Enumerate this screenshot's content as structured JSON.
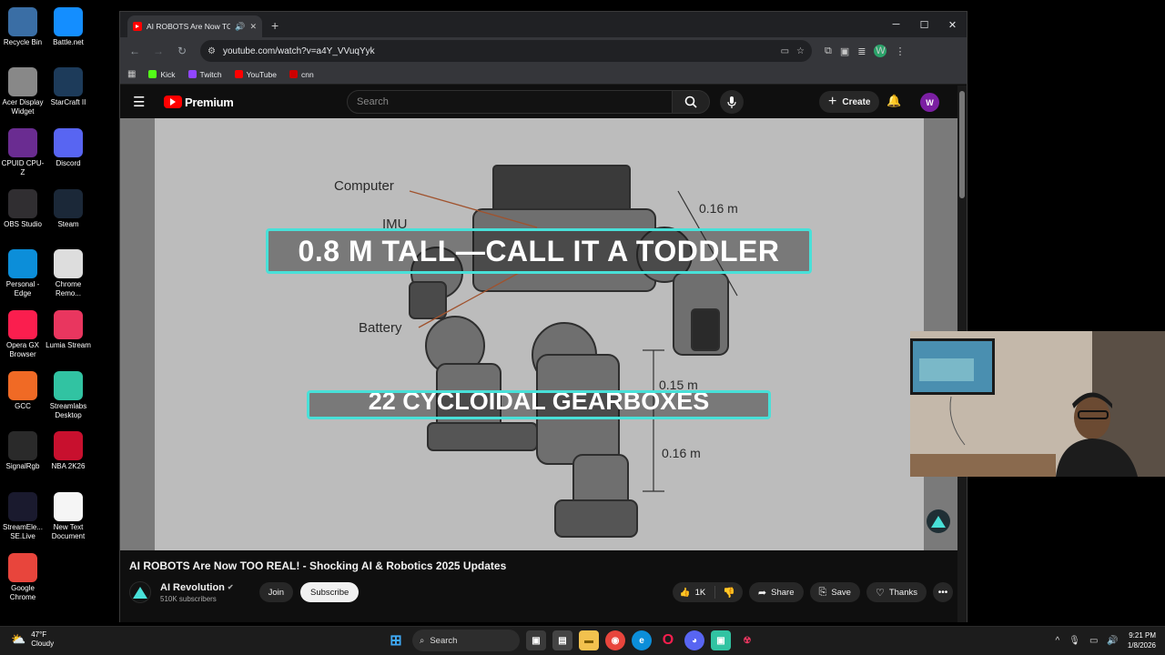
{
  "desktop": {
    "icons": [
      {
        "label": "Recycle Bin",
        "icon": "recycle-bin-icon",
        "color": "#3a6ea5"
      },
      {
        "label": "Battle.net",
        "icon": "battlenet-icon",
        "color": "#148eff"
      },
      {
        "label": "Acer Display Widget",
        "icon": "acer-icon",
        "color": "#888888"
      },
      {
        "label": "StarCraft II",
        "icon": "starcraft-icon",
        "color": "#1d3b5a"
      },
      {
        "label": "CPUID CPU-Z",
        "icon": "cpuz-icon",
        "color": "#6a2c91"
      },
      {
        "label": "Discord",
        "icon": "discord-icon",
        "color": "#5865f2"
      },
      {
        "label": "OBS Studio",
        "icon": "obs-icon",
        "color": "#302e31"
      },
      {
        "label": "Steam",
        "icon": "steam-icon",
        "color": "#1b2838"
      },
      {
        "label": "Personal - Edge",
        "icon": "edge-icon",
        "color": "#0c8ed9"
      },
      {
        "label": "Chrome Remo...",
        "icon": "chrome-remote-icon",
        "color": "#dddddd"
      },
      {
        "label": "Opera GX Browser",
        "icon": "opera-gx-icon",
        "color": "#fa1e4e"
      },
      {
        "label": "Lumia Stream",
        "icon": "lumia-icon",
        "color": "#e9365f"
      },
      {
        "label": "GCC",
        "icon": "gcc-icon",
        "color": "#f06a25"
      },
      {
        "label": "Streamlabs Desktop",
        "icon": "streamlabs-icon",
        "color": "#31c3a2"
      },
      {
        "label": "SignalRgb",
        "icon": "signalrgb-icon",
        "color": "#2a2a2a"
      },
      {
        "label": "NBA 2K26",
        "icon": "nba2k-icon",
        "color": "#c8102e"
      },
      {
        "label": "StreamEle... SE.Live",
        "icon": "streamelements-icon",
        "color": "#1a1a2e"
      },
      {
        "label": "New Text Document",
        "icon": "text-document-icon",
        "color": "#f5f5f5"
      },
      {
        "label": "Google Chrome",
        "icon": "chrome-icon",
        "color": "#e8453c"
      }
    ]
  },
  "browser": {
    "tab_title": "AI ROBOTS Are Now TOO REAL!",
    "url": "youtube.com/watch?v=a4Y_VVuqYyk",
    "bookmarks": [
      {
        "label": "Kick",
        "color": "#53fc18"
      },
      {
        "label": "Twitch",
        "color": "#9146ff"
      },
      {
        "label": "YouTube",
        "color": "#ff0000"
      },
      {
        "label": "cnn",
        "color": "#cc0000"
      }
    ],
    "profile_initial": "W"
  },
  "youtube": {
    "logo_text": "Premium",
    "search_placeholder": "Search",
    "create_label": "Create",
    "avatar_initial": "W",
    "video": {
      "labels": [
        "Computer",
        "IMU",
        "Battery",
        "0.16 m",
        "0.15 m",
        "0.16 m"
      ],
      "caption_main": "0.8 M TALL—CALL IT A TODDLER",
      "caption_secondary": "22 CYCLOIDAL GEARBOXES"
    },
    "title": "AI ROBOTS Are Now TOO REAL! - Shocking AI & Robotics 2025 Updates",
    "channel": {
      "name": "AI Revolution",
      "subscribers": "510K subscribers",
      "join_label": "Join",
      "subscribe_label": "Subscribe"
    },
    "actions": {
      "likes": "1K",
      "share_label": "Share",
      "save_label": "Save",
      "thanks_label": "Thanks"
    }
  },
  "taskbar": {
    "weather_temp": "47°F",
    "weather_desc": "Cloudy",
    "search_label": "Search",
    "time": "9:21 PM",
    "date": "1/8/2026"
  }
}
